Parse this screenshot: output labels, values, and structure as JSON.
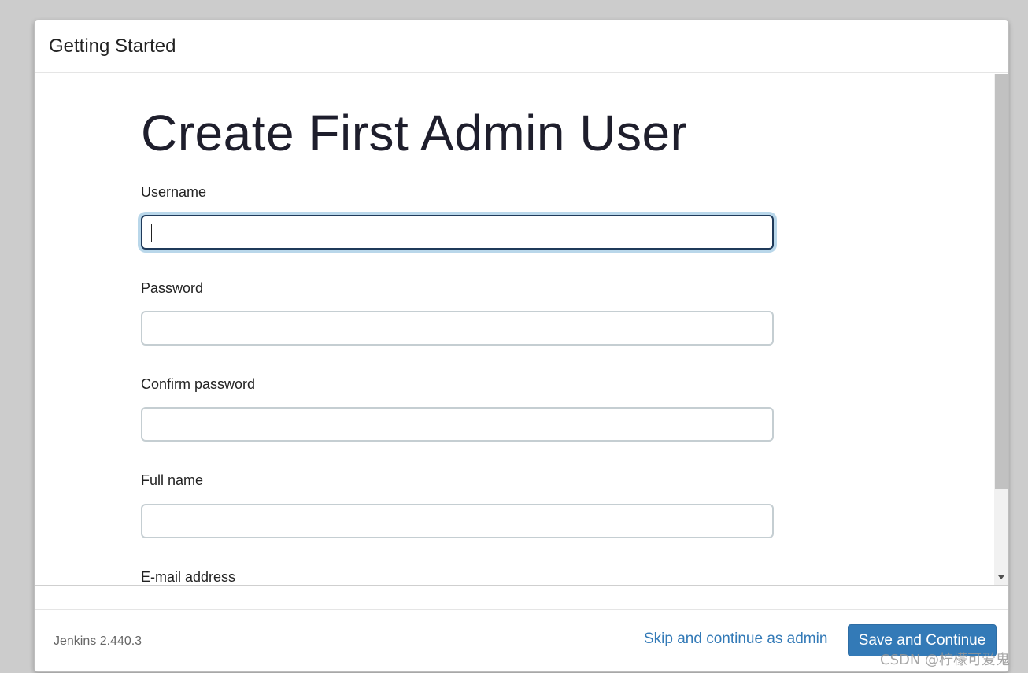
{
  "dialog": {
    "title": "Getting Started"
  },
  "form": {
    "heading": "Create First Admin User",
    "fields": [
      {
        "label": "Username",
        "value": "",
        "focused": true
      },
      {
        "label": "Password",
        "value": ""
      },
      {
        "label": "Confirm password",
        "value": ""
      },
      {
        "label": "Full name",
        "value": ""
      },
      {
        "label": "E-mail address",
        "value": ""
      }
    ]
  },
  "footer": {
    "version": "Jenkins 2.440.3",
    "skip_label": "Skip and continue as admin",
    "save_label": "Save and Continue"
  },
  "watermark": "CSDN @柠檬可爱鬼",
  "colors": {
    "primary": "#337ab7",
    "focus_border": "#1f3a5a",
    "focus_ring": "#b9d7ea"
  }
}
